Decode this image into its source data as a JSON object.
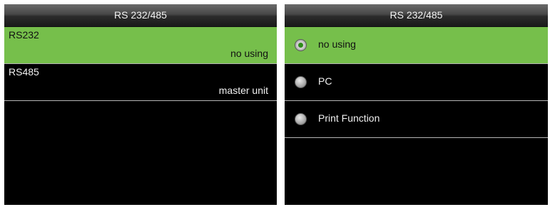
{
  "left_screen": {
    "title": "RS 232/485",
    "items": [
      {
        "label": "RS232",
        "value": "no using",
        "selected": true
      },
      {
        "label": "RS485",
        "value": "master unit",
        "selected": false
      }
    ]
  },
  "right_screen": {
    "title": "RS 232/485",
    "options": [
      {
        "label": "no using",
        "checked": true
      },
      {
        "label": "PC",
        "checked": false
      },
      {
        "label": "Print Function",
        "checked": false
      }
    ]
  },
  "colors": {
    "selection": "#76bf4b",
    "radio_checked": "#2e8c1a",
    "background": "#000000"
  }
}
